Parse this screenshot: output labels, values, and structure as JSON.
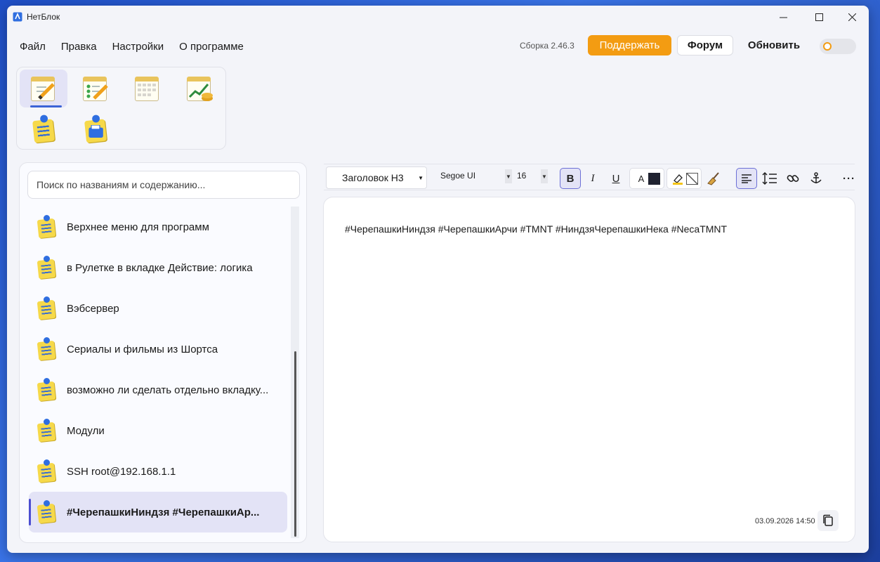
{
  "window": {
    "title": "НетБлок",
    "controls": {
      "minimize": "—",
      "maximize": "☐",
      "close": "✕"
    }
  },
  "menu": {
    "items": [
      "Файл",
      "Правка",
      "Настройки",
      "О программе"
    ]
  },
  "header": {
    "build": "Сборка 2.46.3",
    "donate_label": "Поддержать",
    "forum_label": "Форум",
    "update_label": "Обновить",
    "theme_toggle": "off"
  },
  "modules": [
    {
      "icon": "notepad-pencil-icon",
      "active": true
    },
    {
      "icon": "checklist-pencil-icon",
      "active": false
    },
    {
      "icon": "calendar-icon",
      "active": false
    },
    {
      "icon": "finance-chart-icon",
      "active": false
    },
    {
      "icon": "sticky-note-icon",
      "active": false
    },
    {
      "icon": "clipboard-folder-icon",
      "active": false
    }
  ],
  "search": {
    "placeholder": "Поиск по названиям и содержанию..."
  },
  "notes": [
    {
      "title": "Верхнее меню для программ",
      "selected": false
    },
    {
      "title": "в Рулетке в вкладке Действие: логика",
      "selected": false
    },
    {
      "title": "Вэбсервер",
      "selected": false
    },
    {
      "title": "Сериалы и фильмы из Шортса",
      "selected": false
    },
    {
      "title": "возможно ли сделать отдельно вкладку...",
      "selected": false
    },
    {
      "title": "Модули",
      "selected": false
    },
    {
      "title": "SSH root@192.168.1.1",
      "selected": false
    },
    {
      "title": "#ЧерепашкиНиндзя #ЧерепашкиАр...",
      "selected": true
    }
  ],
  "toolbar": {
    "heading_style": "Заголовок H3",
    "font_family": "Segoe UI",
    "font_size": "16",
    "bold": "B",
    "italic": "I",
    "underline": "U",
    "text_color_label": "A",
    "text_color": "#1f2230",
    "more": "···"
  },
  "editor": {
    "content": "#ЧерепашкиНиндзя #ЧерепашкиАрчи #TMNT #НиндзяЧерепашкиНека #NecaTMNT",
    "timestamp": "03.09.2026 14:50"
  },
  "colors": {
    "accent": "#f39c12",
    "selection": "#e3e3f6",
    "selection_bar": "#4b4ed1",
    "underline": "#3b63d6"
  }
}
